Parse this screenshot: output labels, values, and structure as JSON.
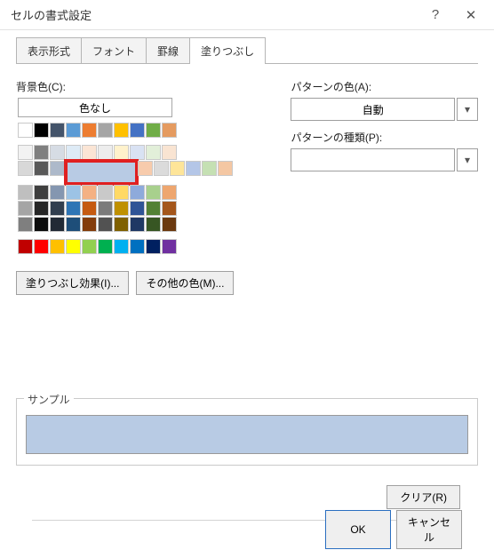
{
  "title": "セルの書式設定",
  "tabs": [
    "表示形式",
    "フォント",
    "罫線",
    "塗りつぶし"
  ],
  "active_tab": 3,
  "labels": {
    "bgcolor": "背景色(C):",
    "nocolor": "色なし",
    "fill_effect": "塗りつぶし効果(I)...",
    "more_colors": "その他の色(M)...",
    "pattern_color": "パターンの色(A):",
    "pattern_auto": "自動",
    "pattern_type": "パターンの種類(P):",
    "sample": "サンプル",
    "clear": "クリア(R)",
    "ok": "OK",
    "cancel": "キャンセル"
  },
  "selected_color": "#b8cbe4",
  "palette_rows": [
    [
      "#ffffff",
      "#000000",
      "#44546a",
      "#5b9bd5",
      "#ed7d31",
      "#a5a5a5",
      "#ffc000",
      "#4472c4",
      "#70ad47",
      "#e59b60"
    ],
    [
      "#f2f2f2",
      "#7f7f7f",
      "#d6dce4",
      "#deebf6",
      "#fbe5d5",
      "#ededed",
      "#fff2cc",
      "#d9e2f3",
      "#e2efd9",
      "#f9e4d2"
    ],
    [
      "#d8d8d8",
      "#595959",
      "#adb9ca",
      "#b8cbe4",
      "#f7cbac",
      "#dbdbdb",
      "#fee599",
      "#b4c6e7",
      "#c5e0b3",
      "#f4c7a3"
    ],
    [
      "#bfbfbf",
      "#3f3f3f",
      "#8496b0",
      "#9cc3e5",
      "#f4b183",
      "#c9c9c9",
      "#ffd965",
      "#8eaadb",
      "#a8d08d",
      "#eea66f"
    ],
    [
      "#a5a5a5",
      "#262626",
      "#323f4f",
      "#2e75b5",
      "#c55a11",
      "#7b7b7b",
      "#bf9000",
      "#2f5496",
      "#538135",
      "#a4561b"
    ],
    [
      "#7f7f7f",
      "#0c0c0c",
      "#222a35",
      "#1e4e79",
      "#833c0b",
      "#525252",
      "#7f6000",
      "#1f3864",
      "#375623",
      "#6b390f"
    ]
  ],
  "standard_row": [
    "#c00000",
    "#ff0000",
    "#ffc000",
    "#ffff00",
    "#92d050",
    "#00b050",
    "#00b0f0",
    "#0070c0",
    "#002060",
    "#7030a0"
  ],
  "selected_cell": {
    "row": 2,
    "col": 3
  }
}
